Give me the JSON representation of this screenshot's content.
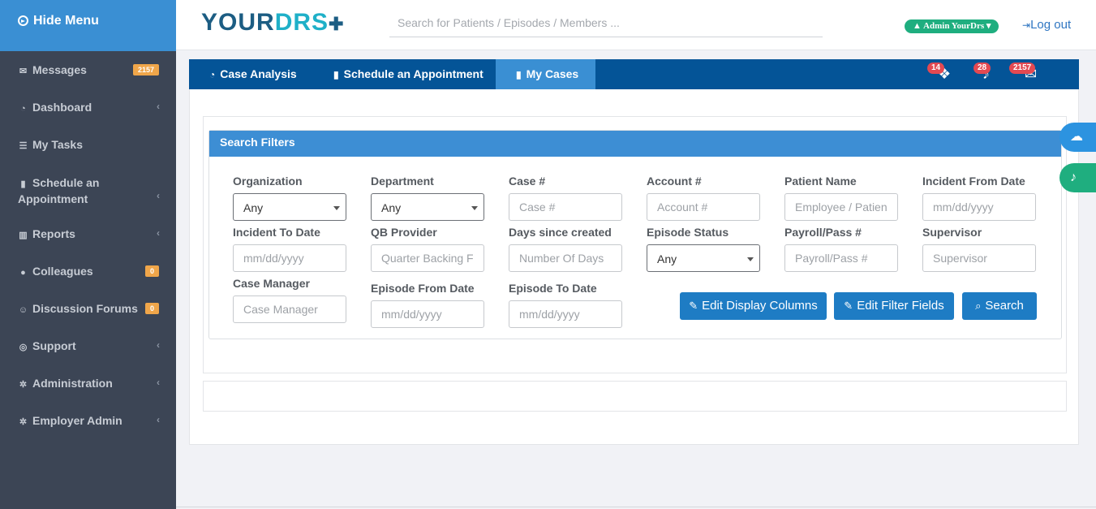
{
  "sidebar": {
    "hide_menu": "Hide Menu",
    "items": [
      {
        "label": "Messages",
        "icon": "envelope-icon",
        "badge": "2157"
      },
      {
        "label": "Dashboard",
        "icon": "dashboard-icon"
      },
      {
        "label": "My Tasks",
        "icon": "tasks-icon"
      },
      {
        "label": "Schedule an",
        "label2": "Appointment",
        "icon": "document-icon"
      },
      {
        "label": "Reports",
        "icon": "bar-chart-icon"
      },
      {
        "label": "Colleagues",
        "icon": "users-icon",
        "badge": "0"
      },
      {
        "label": "Discussion Forums",
        "icon": "smile-icon",
        "badge": "0"
      },
      {
        "label": "Support",
        "icon": "life-ring-icon"
      },
      {
        "label": "Administration",
        "icon": "gear-icon"
      },
      {
        "label": "Employer Admin",
        "icon": "gear-icon"
      }
    ]
  },
  "header": {
    "logo_part1": "YOUR",
    "logo_part2": "DRS",
    "search_placeholder": "Search for Patients / Episodes / Members ...",
    "admin_label": "Admin YourDrs",
    "logout_label": "Log out"
  },
  "tabs": [
    {
      "label": "Case Analysis",
      "icon": "dashboard-icon"
    },
    {
      "label": "Schedule an Appointment",
      "icon": "document-icon"
    },
    {
      "label": "My Cases",
      "icon": "document-icon",
      "active": true
    }
  ],
  "notifications": {
    "tags_count": "14",
    "bell_count": "28",
    "mail_count": "2157"
  },
  "filters": {
    "title": "Search Filters",
    "fields": {
      "organization": {
        "label": "Organization",
        "value": "Any"
      },
      "department": {
        "label": "Department",
        "value": "Any"
      },
      "case": {
        "label": "Case #",
        "placeholder": "Case #"
      },
      "account": {
        "label": "Account #",
        "placeholder": "Account #"
      },
      "patient_name": {
        "label": "Patient Name",
        "placeholder": "Employee / Patien"
      },
      "incident_from": {
        "label": "Incident From Date",
        "placeholder": "mm/dd/yyyy"
      },
      "incident_to": {
        "label": "Incident To Date",
        "placeholder": "mm/dd/yyyy"
      },
      "qb_provider": {
        "label": "QB Provider",
        "placeholder": "Quarter Backing F"
      },
      "days_since": {
        "label": "Days since created",
        "placeholder": "Number Of Days"
      },
      "episode_status": {
        "label": "Episode Status",
        "value": "Any"
      },
      "payroll": {
        "label": "Payroll/Pass #",
        "placeholder": "Payroll/Pass #"
      },
      "supervisor": {
        "label": "Supervisor",
        "placeholder": "Supervisor"
      },
      "case_manager": {
        "label": "Case Manager",
        "placeholder": "Case Manager"
      },
      "episode_from": {
        "label": "Episode From Date",
        "placeholder": "mm/dd/yyyy"
      },
      "episode_to": {
        "label": "Episode To Date",
        "placeholder": "mm/dd/yyyy"
      }
    },
    "buttons": {
      "edit_display": "Edit Display Columns",
      "edit_filter": "Edit Filter Fields",
      "search": "Search"
    }
  },
  "colors": {
    "sidebar_bg": "#3c4555",
    "primary_blue": "#3a8fd3",
    "tabbar_blue": "#045497",
    "button_blue": "#1e7cc4",
    "green": "#1fae7f",
    "badge_red": "#e34952",
    "badge_orange": "#f0a64a"
  }
}
